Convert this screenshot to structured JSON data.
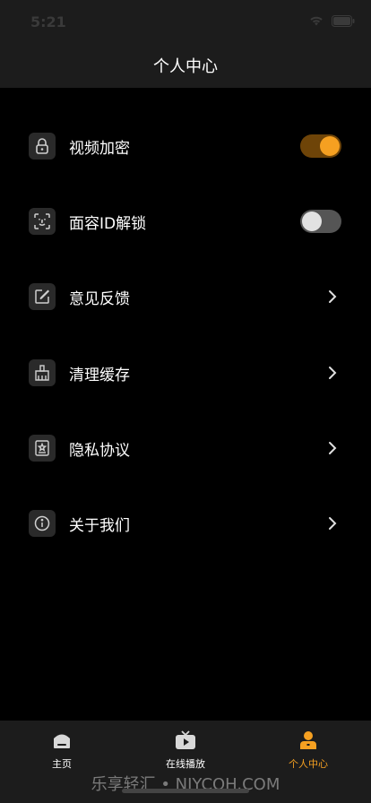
{
  "status_bar": {
    "time": "5:21"
  },
  "header": {
    "title": "个人中心"
  },
  "menu": {
    "items": [
      {
        "label": "视频加密",
        "icon": "lock-icon",
        "control": "toggle",
        "toggle_on": true
      },
      {
        "label": "面容ID解锁",
        "icon": "face-id-icon",
        "control": "toggle",
        "toggle_on": false
      },
      {
        "label": "意见反馈",
        "icon": "edit-icon",
        "control": "chevron"
      },
      {
        "label": "清理缓存",
        "icon": "broom-icon",
        "control": "chevron"
      },
      {
        "label": "隐私协议",
        "icon": "document-star-icon",
        "control": "chevron"
      },
      {
        "label": "关于我们",
        "icon": "info-icon",
        "control": "chevron"
      }
    ]
  },
  "tabbar": {
    "tabs": [
      {
        "label": "主页",
        "icon": "home-icon"
      },
      {
        "label": "在线播放",
        "icon": "tv-play-icon"
      },
      {
        "label": "个人中心",
        "icon": "user-icon",
        "active": true
      }
    ]
  },
  "watermark": {
    "text": "乐享轻汇 • NJYCQH.COM"
  },
  "colors": {
    "accent": "#f5a021",
    "toggle_on_track": "#6e4408",
    "background": "#000000",
    "bar": "#1c1c1c"
  }
}
